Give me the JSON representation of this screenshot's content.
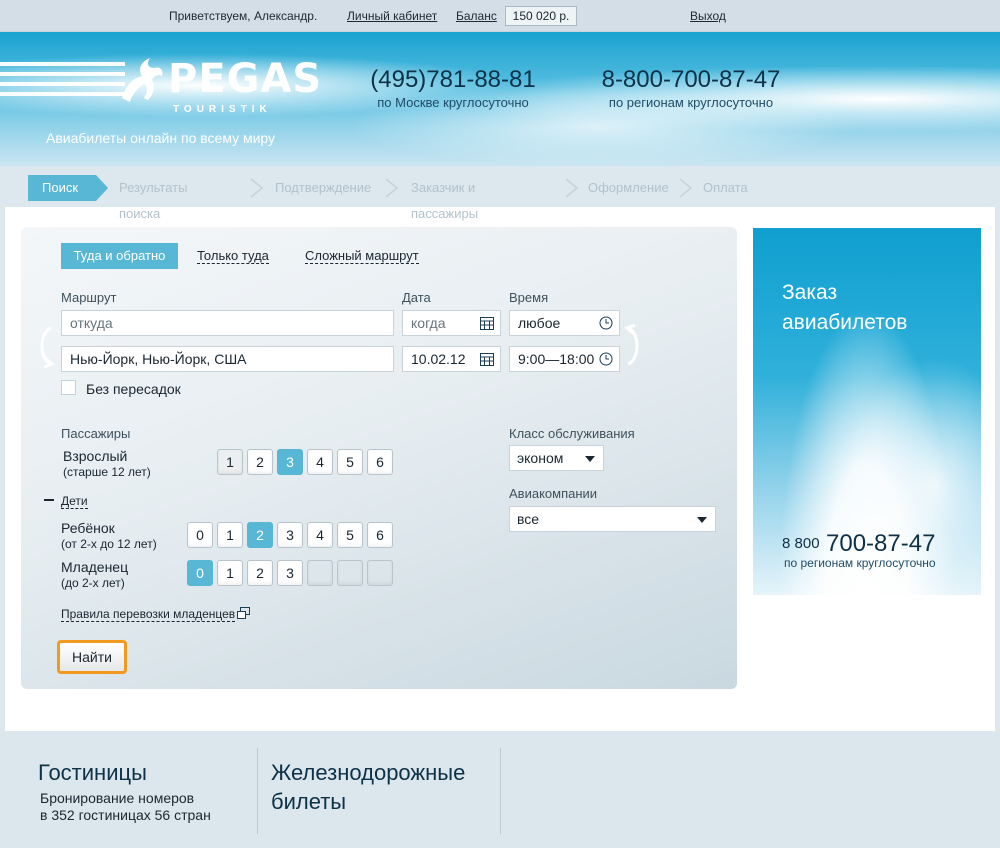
{
  "topbar": {
    "greeting": "Приветствуем, Александр.",
    "cabinet_link": "Личный кабинет",
    "balance_label": "Баланс",
    "balance_value": "150 020 р.",
    "logout_link": "Выход"
  },
  "header": {
    "logo_text": "PEGAS",
    "logo_sub": "TOURISTIK",
    "tagline": "Авиабилеты онлайн по всему миру",
    "phone_moscow": "(495)781-88-81",
    "phone_moscow_caption": "по Москве круглосуточно",
    "phone_regions": "8-800-700-87-47",
    "phone_regions_caption": "по регионам круглосуточно"
  },
  "steps": {
    "active": "Поиск",
    "items": [
      "Результаты поиска",
      "Подтверждение",
      "Заказчик и пассажиры",
      "Оформление",
      "Оплата"
    ]
  },
  "form": {
    "tabs": [
      "Туда и обратно",
      "Только туда",
      "Сложный маршрут"
    ],
    "route_label": "Маршрут",
    "date_label": "Дата",
    "time_label": "Время",
    "from_placeholder": "откуда",
    "to_value": "Нью-Йорк, Нью-Йорк, США",
    "date1_placeholder": "когда",
    "date2_value": "10.02.12",
    "time1_value": "любое",
    "time2_value": "9:00—18:00",
    "no_transfers_label": "Без пересадок",
    "passengers_label": "Пассажиры",
    "adult_label": "Взрослый",
    "adult_sub": "(старше 12 лет)",
    "adult_options": [
      "1",
      "2",
      "3",
      "4",
      "5",
      "6"
    ],
    "adult_selected": "3",
    "children_toggle": "Дети",
    "child_label": "Ребёнок",
    "child_sub": "(от 2-х до 12 лет)",
    "child_options": [
      "0",
      "1",
      "2",
      "3",
      "4",
      "5",
      "6"
    ],
    "child_selected": "2",
    "infant_label": "Младенец",
    "infant_sub": "(до 2-х лет)",
    "infant_options": [
      "0",
      "1",
      "2",
      "3"
    ],
    "infant_selected": "0",
    "infant_rules_link": "Правила перевозки младенцев",
    "class_label": "Класс обслуживания",
    "class_value": "эконом",
    "airline_label": "Авиакомпании",
    "airline_value": "все",
    "find_button": "Найти"
  },
  "banner": {
    "title": "Заказ авиабилетов",
    "phone_prefix": "8 800",
    "phone_number": "700-87-47",
    "phone_caption": "по регионам круглосуточно"
  },
  "bottom": {
    "hotels_title": "Гостиницы",
    "hotels_text_line1": "Бронирование номеров",
    "hotels_text_line2": "в 352 гостиницах 56 стран",
    "rail_title_line1": "Железнодорожные",
    "rail_title_line2": "билеты"
  },
  "colors": {
    "accent": "#57b7d4",
    "button_border": "#f39a1e",
    "text_dark": "#0d3147"
  }
}
